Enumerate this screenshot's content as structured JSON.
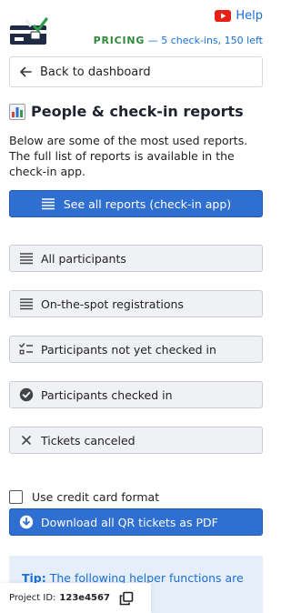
{
  "header": {
    "help_label": "Help",
    "pricing_tag": "PRICING",
    "pricing_detail": " — 5 check-ins, 150 left"
  },
  "nav": {
    "back_label": "Back to dashboard"
  },
  "page": {
    "title": "People & check-in reports",
    "description": "Below are some of the most used reports. The full list of reports is available in the check-in app."
  },
  "actions": {
    "see_all_label": "See all reports (check-in app)",
    "reports": [
      {
        "label": "All participants",
        "icon": "list-icon"
      },
      {
        "label": "On-the-spot registrations",
        "icon": "list-icon"
      },
      {
        "label": "Participants not yet checked in",
        "icon": "checklist-icon"
      },
      {
        "label": "Participants checked in",
        "icon": "check-circle-icon"
      },
      {
        "label": "Tickets canceled",
        "icon": "close-icon"
      }
    ],
    "credit_card_label": "Use credit card format",
    "download_label": "Download all QR tickets as PDF"
  },
  "tip": {
    "prefix": "Tip:",
    "text": " The following helper functions are ... Check their ...ail."
  },
  "footer": {
    "project_label": "Project ID:",
    "project_id": "123e4567"
  },
  "colors": {
    "primary": "#2f6fd1",
    "link": "#1a6fd8",
    "pricing": "#2e8b3a"
  }
}
